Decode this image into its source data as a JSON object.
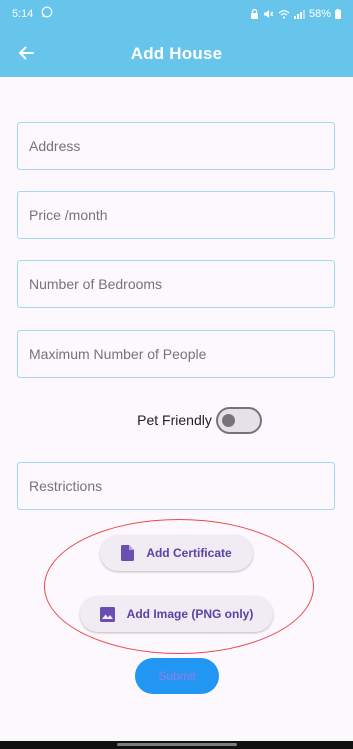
{
  "status_bar": {
    "time": "5:14",
    "battery": "58%",
    "icons": [
      "whatsapp-icon",
      "notification-lock-icon",
      "mute-icon",
      "wifi-icon",
      "signal-icon",
      "battery-icon"
    ]
  },
  "app_bar": {
    "title": "Add House",
    "back_icon": "arrow-left-icon",
    "color": "#67c5ec"
  },
  "form": {
    "address_placeholder": "Address",
    "price_placeholder": "Price /month",
    "bedrooms_placeholder": "Number of Bedrooms",
    "people_placeholder": "Maximum Number of People",
    "pet_friendly_label": "Pet Friendly",
    "pet_friendly_on": false,
    "restrictions_placeholder": "Restrictions",
    "field_border_color": "#a6d9ec"
  },
  "uploads": {
    "certificate_label": "Add Certificate",
    "certificate_icon": "document-icon",
    "image_label": "Add Image (PNG only)",
    "image_icon": "image-icon",
    "highlight_color": "#e84b4b"
  },
  "submit": {
    "label": "Submit",
    "color": "#2196f3"
  }
}
